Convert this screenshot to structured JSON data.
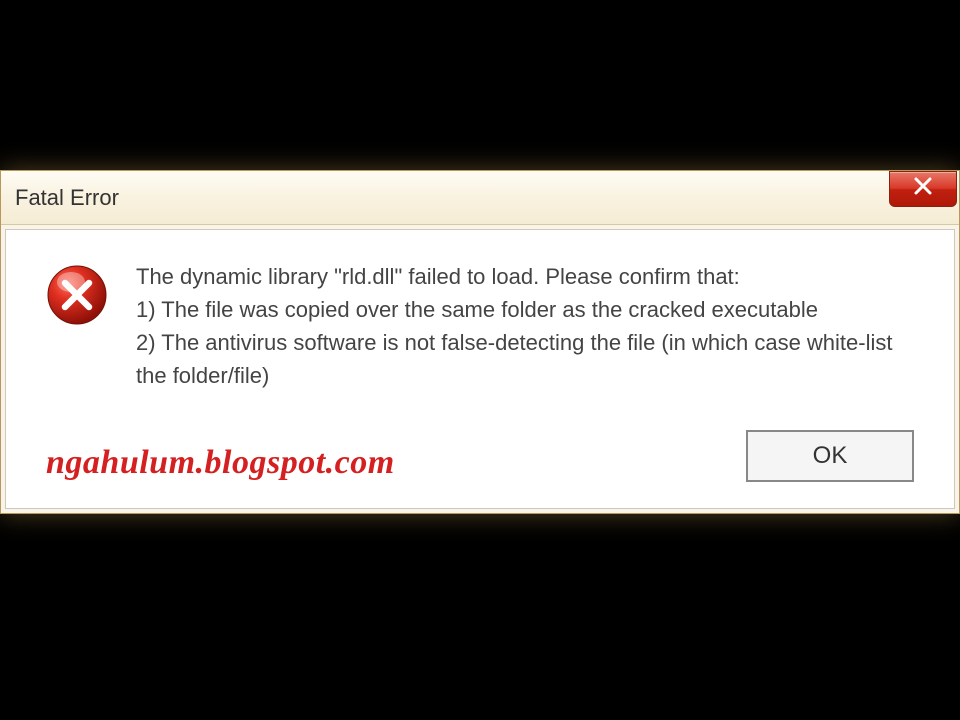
{
  "dialog": {
    "title": "Fatal Error",
    "message": "The dynamic library \"rld.dll\" failed to load. Please confirm that:\n1) The file was copied over the same folder as the cracked executable\n2) The antivirus software is not false-detecting the file (in which case white-list the folder/file)",
    "ok_label": "OK"
  },
  "watermark": "ngahulum.blogspot.com"
}
